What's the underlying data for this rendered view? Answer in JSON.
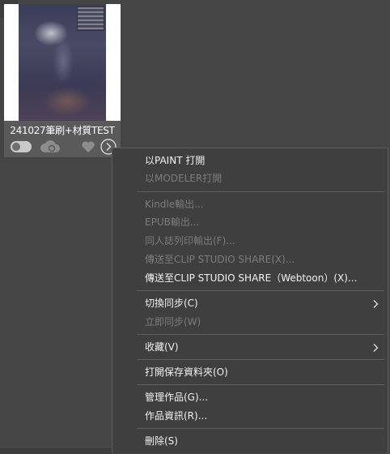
{
  "card": {
    "title": "241027筆刷+材質TEST"
  },
  "menu": {
    "items": [
      {
        "label": "以PAINT 打開",
        "enabled": true
      },
      {
        "label": "以MODELER打開",
        "enabled": false
      },
      {
        "label": "Kindle輸出...",
        "enabled": false
      },
      {
        "label": "EPUB輸出...",
        "enabled": false
      },
      {
        "label": "同人誌列印輸出(F)...",
        "enabled": false
      },
      {
        "label": "傳送至CLIP STUDIO SHARE(X)...",
        "enabled": false
      },
      {
        "label": "傳送至CLIP STUDIO SHARE（Webtoon）(X)...",
        "enabled": true
      },
      {
        "label": "切換同步(C)",
        "enabled": true,
        "submenu": true
      },
      {
        "label": "立即同步(W)",
        "enabled": false
      },
      {
        "label": "收藏(V)",
        "enabled": true,
        "submenu": true
      },
      {
        "label": "打開保存資料夾(O)",
        "enabled": true
      },
      {
        "label": "管理作品(G)...",
        "enabled": true
      },
      {
        "label": "作品資訊(R)...",
        "enabled": true
      },
      {
        "label": "刪除(S)",
        "enabled": true
      }
    ]
  },
  "icons": {
    "toggle": "sync-toggle-icon",
    "cloud": "cloud-sync-icon",
    "heart": "heart-icon",
    "more": "chevron-circle-right-icon",
    "submenu": "chevron-right-icon"
  },
  "colors": {
    "background": "#454545",
    "menu_background": "#3f3f3f",
    "text": "#f2f2f2",
    "disabled_text": "#7c7c7c"
  }
}
